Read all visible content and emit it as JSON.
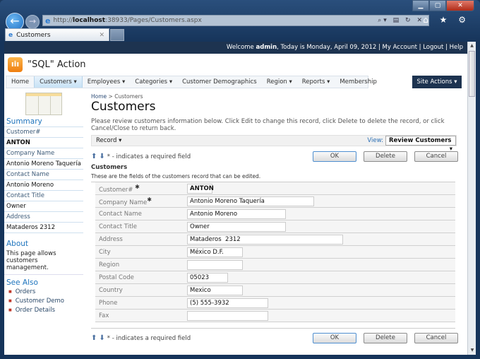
{
  "browser": {
    "url_prefix": "http://",
    "url_host": "localhost",
    "url_rest": ":38933/Pages/Customers.aspx",
    "tab_title": "Customers",
    "close_glyph": "✕",
    "addr_tools": "⌕▾ ▤ ↻ ✕",
    "right_icons": "⌂ ★ ⚙"
  },
  "topbar": {
    "welcome": "Welcome ",
    "user": "admin",
    "date_text": ", Today is Monday, April 09, 2012 | ",
    "my_account": "My Account",
    "logout": "Logout",
    "help": "Help",
    "sep": " | "
  },
  "app": {
    "title": "\"SQL\" Action",
    "site_actions": "Site Actions ▾"
  },
  "menu": [
    {
      "label": "Home"
    },
    {
      "label": "Customers ▾",
      "active": true
    },
    {
      "label": "Employees ▾"
    },
    {
      "label": "Categories ▾"
    },
    {
      "label": "Customer Demographics"
    },
    {
      "label": "Region ▾"
    },
    {
      "label": "Reports ▾"
    },
    {
      "label": "Membership"
    }
  ],
  "sidebar": {
    "summary_title": "Summary",
    "summary": [
      {
        "label": "Customer#",
        "value": "ANTON"
      },
      {
        "label": "Company Name",
        "value": "Antonio Moreno Taquería"
      },
      {
        "label": "Contact Name",
        "value": "Antonio Moreno"
      },
      {
        "label": "Contact Title",
        "value": "Owner"
      },
      {
        "label": "Address",
        "value": "Mataderos 2312"
      }
    ],
    "about_title": "About",
    "about_text": "This page allows customers management.",
    "see_also_title": "See Also",
    "links": [
      "Orders",
      "Customer Demo",
      "Order Details"
    ]
  },
  "main": {
    "breadcrumb_home": "Home",
    "breadcrumb_sep": " > ",
    "breadcrumb_current": "Customers",
    "title": "Customers",
    "description": "Please review customers information below. Click Edit to change this record, click Delete to delete the record, or click Cancel/Close to return back.",
    "record_menu": "Record ▾",
    "view_label": "View:",
    "view_value": "Review Customers",
    "view_arrow": "▾",
    "required_note": "* - indicates a required field",
    "buttons": {
      "ok": "OK",
      "delete": "Delete",
      "cancel": "Cancel"
    },
    "section_title": "Customers",
    "section_desc": "These are the fields of the customers record that can be edited.",
    "fields": [
      {
        "label": "Customer#",
        "required": true,
        "value": "ANTON"
      },
      {
        "label": "Company Name",
        "required": true,
        "value": "Antonio Moreno Taquería"
      },
      {
        "label": "Contact Name",
        "required": false,
        "value": "Antonio Moreno"
      },
      {
        "label": "Contact Title",
        "required": false,
        "value": "Owner"
      },
      {
        "label": "Address",
        "required": false,
        "value": "Mataderos  2312"
      },
      {
        "label": "City",
        "required": false,
        "value": "México D.F."
      },
      {
        "label": "Region",
        "required": false,
        "value": ""
      },
      {
        "label": "Postal Code",
        "required": false,
        "value": "05023"
      },
      {
        "label": "Country",
        "required": false,
        "value": "Mexico"
      },
      {
        "label": "Phone",
        "required": false,
        "value": "(5) 555-3932"
      },
      {
        "label": "Fax",
        "required": false,
        "value": ""
      }
    ]
  }
}
